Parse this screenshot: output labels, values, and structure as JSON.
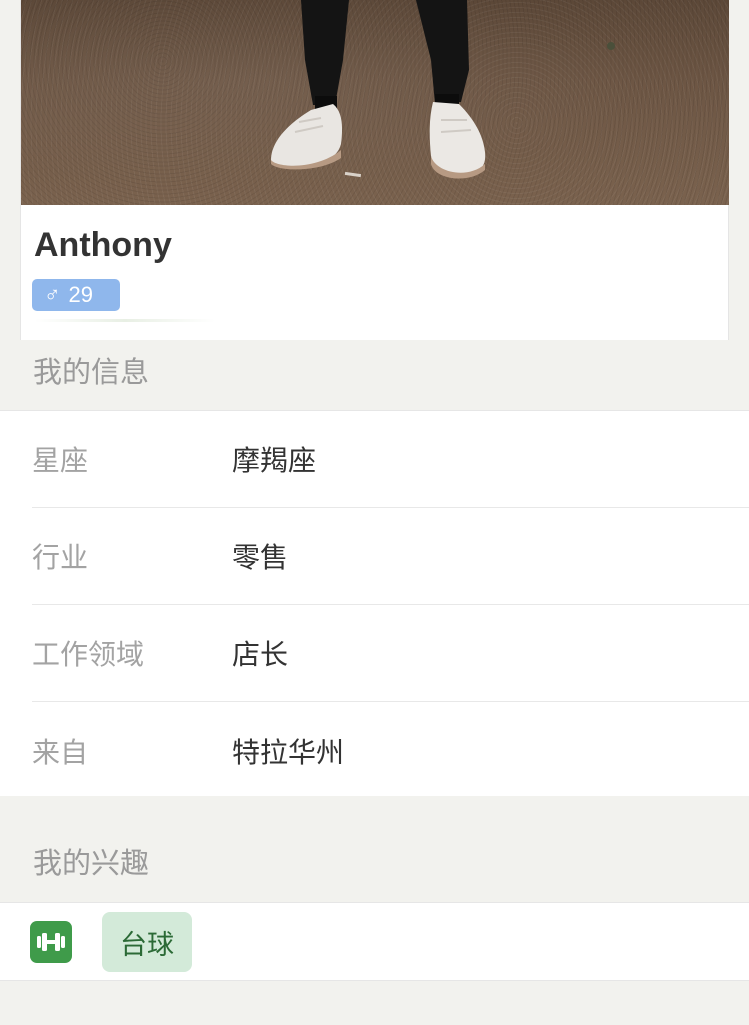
{
  "profile": {
    "name": "Anthony",
    "gender_symbol": "♂",
    "age": "29",
    "badge_color": "#8fb7ec"
  },
  "info_section": {
    "title": "我的信息",
    "rows": [
      {
        "key": "星座",
        "value": "摩羯座"
      },
      {
        "key": "行业",
        "value": "零售"
      },
      {
        "key": "工作领域",
        "value": "店长"
      },
      {
        "key": "来自",
        "value": "特拉华州"
      }
    ]
  },
  "interests_section": {
    "title": "我的兴趣",
    "category_icon": "dumbbell-icon",
    "category_color": "#3f9b4a",
    "tags": [
      "台球"
    ]
  }
}
